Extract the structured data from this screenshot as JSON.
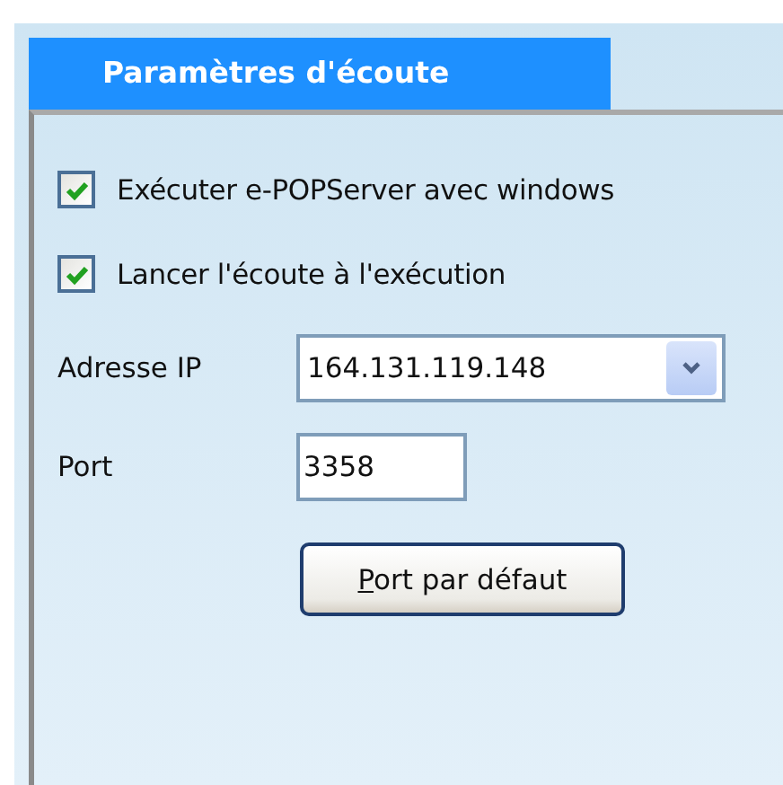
{
  "tabs": [
    {
      "label": "Paramètres d'écoute",
      "selected": true
    }
  ],
  "options": [
    {
      "label": "Exécuter e-POPServer avec windows",
      "checked": true
    },
    {
      "label": "Lancer l'écoute à l'exécution",
      "checked": true
    }
  ],
  "ip_address": {
    "label": "Adresse IP",
    "value": "164.131.119.148"
  },
  "port": {
    "label": "Port",
    "value": "3358"
  },
  "default_port_button": "Port par défaut"
}
